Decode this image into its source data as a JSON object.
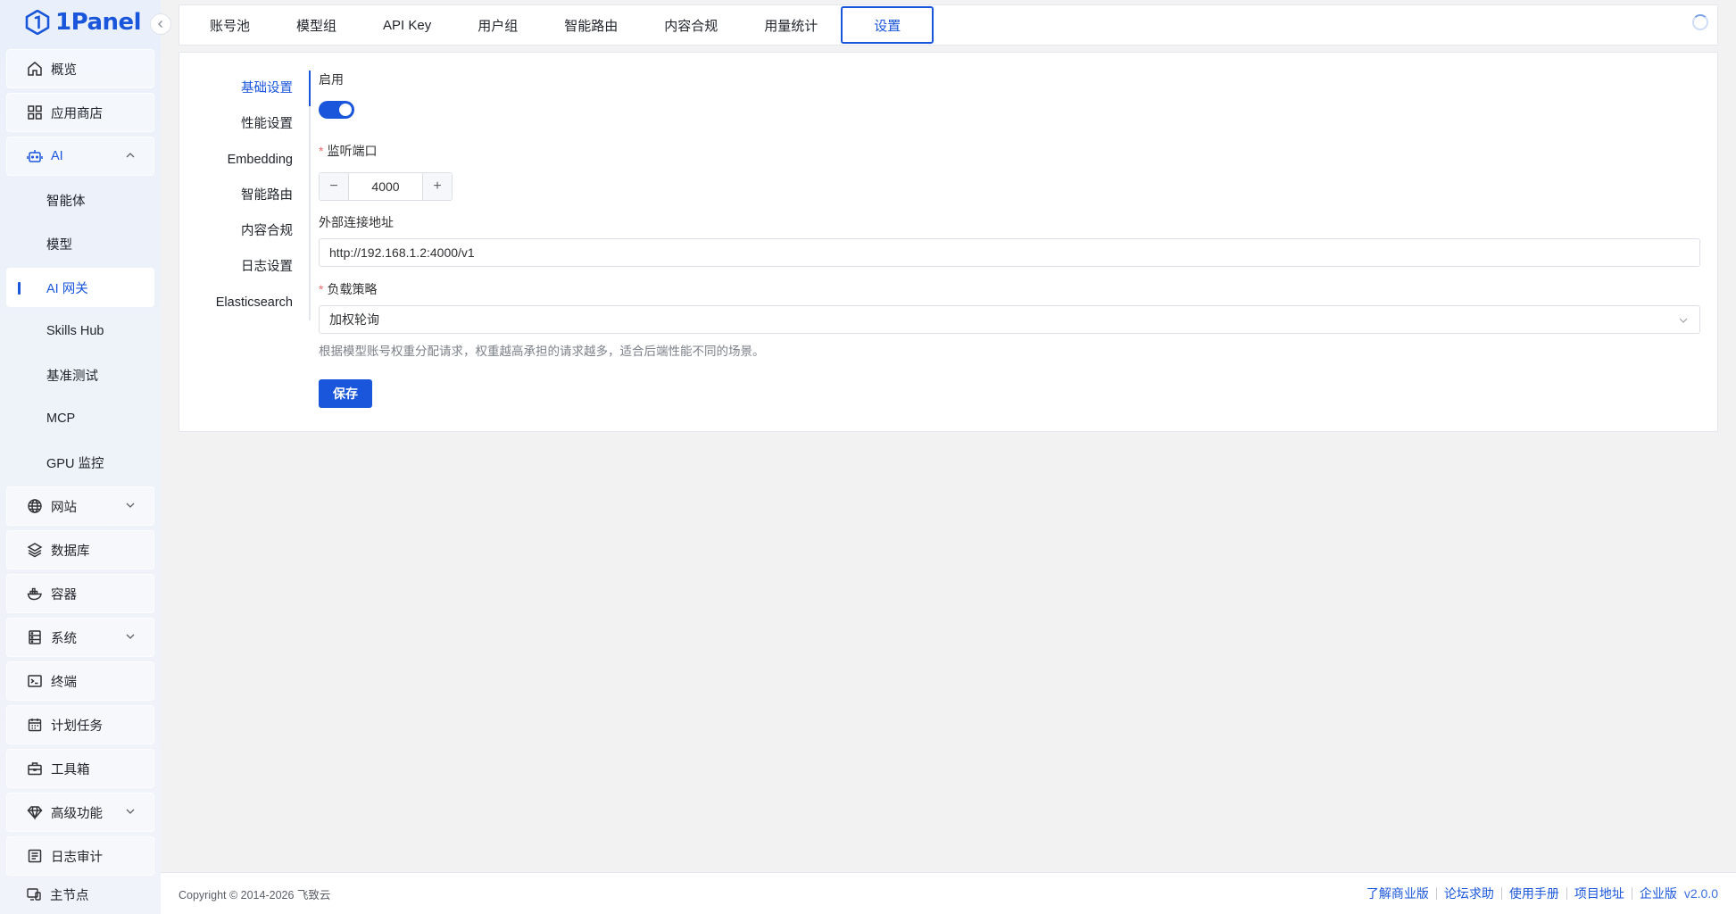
{
  "app": {
    "logo_text": "1Panel"
  },
  "sidebar": {
    "items": [
      {
        "label": "概览",
        "icon": "home-icon"
      },
      {
        "label": "应用商店",
        "icon": "grid-icon"
      },
      {
        "label": "AI",
        "icon": "robot-icon"
      },
      {
        "label": "智能体"
      },
      {
        "label": "模型"
      },
      {
        "label": "AI 网关"
      },
      {
        "label": "Skills Hub"
      },
      {
        "label": "基准测试"
      },
      {
        "label": "MCP"
      },
      {
        "label": "GPU 监控"
      },
      {
        "label": "网站",
        "icon": "globe-icon"
      },
      {
        "label": "数据库",
        "icon": "layers-icon"
      },
      {
        "label": "容器",
        "icon": "docker-icon"
      },
      {
        "label": "系统",
        "icon": "server-icon"
      },
      {
        "label": "终端",
        "icon": "terminal-icon"
      },
      {
        "label": "计划任务",
        "icon": "calendar-icon"
      },
      {
        "label": "工具箱",
        "icon": "toolbox-icon"
      },
      {
        "label": "高级功能",
        "icon": "diamond-icon"
      },
      {
        "label": "日志审计",
        "icon": "log-icon"
      }
    ],
    "node": {
      "label": "主节点"
    }
  },
  "tabs": [
    "账号池",
    "模型组",
    "API Key",
    "用户组",
    "智能路由",
    "内容合规",
    "用量统计",
    "设置"
  ],
  "subnav": [
    "基础设置",
    "性能设置",
    "Embedding",
    "智能路由",
    "内容合规",
    "日志设置",
    "Elasticsearch"
  ],
  "form": {
    "enable_label": "启用",
    "enabled": true,
    "port_label": "监听端口",
    "port_value": "4000",
    "external_label": "外部连接地址",
    "external_value": "http://192.168.1.2:4000/v1",
    "strategy_label": "负载策略",
    "strategy_value": "加权轮询",
    "strategy_hint": "根据模型账号权重分配请求，权重越高承担的请求越多，适合后端性能不同的场景。",
    "required_mark": "*",
    "save_label": "保存",
    "minus": "−",
    "plus": "+"
  },
  "footer": {
    "copyright": "Copyright © 2014-2026 飞致云",
    "links": [
      "了解商业版",
      "论坛求助",
      "使用手册",
      "项目地址",
      "企业版"
    ],
    "version": "v2.0.0"
  },
  "colors": {
    "accent": "#1a56db",
    "required": "#f56c6c"
  }
}
